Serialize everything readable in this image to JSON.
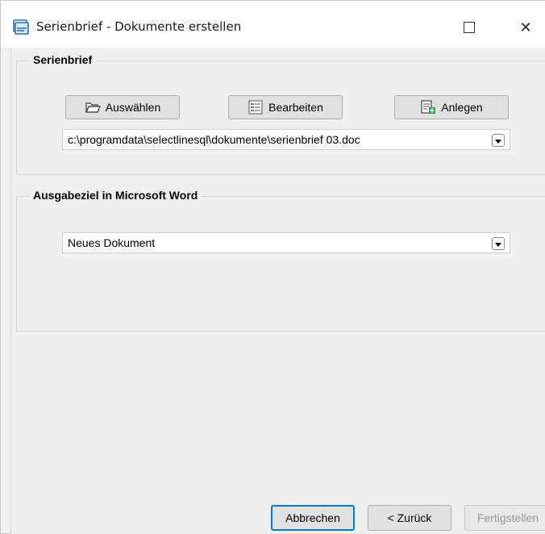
{
  "window": {
    "title": "Serienbrief - Dokumente erstellen",
    "maximize_glyph": "☐",
    "close_glyph": "✕"
  },
  "serienbrief": {
    "title": "Serienbrief",
    "buttons": {
      "auswaehlen": "Auswählen",
      "bearbeiten": "Bearbeiten",
      "anlegen": "Anlegen"
    },
    "path": "c:\\programdata\\selectlinesql\\dokumente\\serienbrief 03.doc"
  },
  "ausgabe": {
    "title": "Ausgabeziel in Microsoft Word",
    "selected": "Neues Dokument"
  },
  "footer": {
    "abbrechen": "Abbrechen",
    "zurueck": "< Zurück",
    "fertigstellen": "Fertigstellen"
  },
  "icons": {
    "app": "document-stack-icon",
    "open": "folder-open-icon",
    "edit": "list-edit-icon",
    "new": "new-document-icon"
  },
  "colors": {
    "accent": "#0078d7",
    "new_icon_green": "#2fa84f"
  }
}
